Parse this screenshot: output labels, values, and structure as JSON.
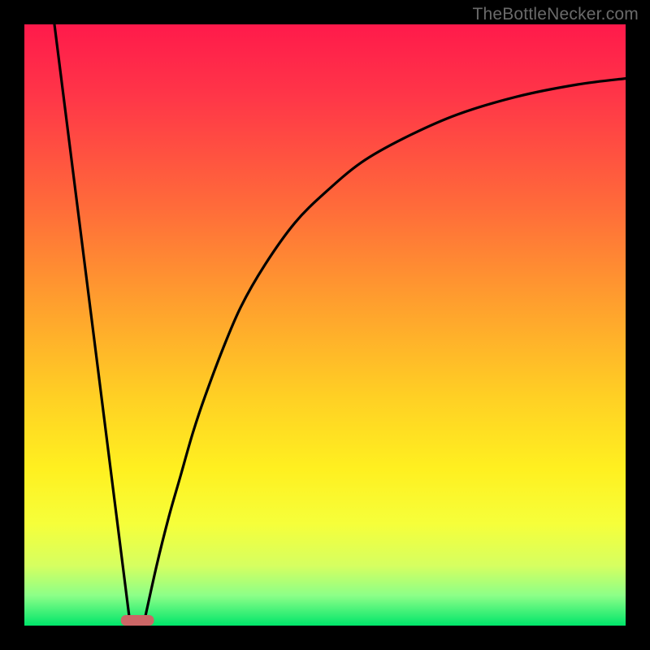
{
  "watermark": "TheBottleNecker.com",
  "chart_data": {
    "type": "line",
    "title": "",
    "xlabel": "",
    "ylabel": "",
    "xlim": [
      0,
      100
    ],
    "ylim": [
      0,
      100
    ],
    "gradient_stops": [
      {
        "offset": 0.0,
        "color": "#ff1a4b"
      },
      {
        "offset": 0.12,
        "color": "#ff3648"
      },
      {
        "offset": 0.3,
        "color": "#ff6a3a"
      },
      {
        "offset": 0.46,
        "color": "#ff9e2e"
      },
      {
        "offset": 0.62,
        "color": "#ffd024"
      },
      {
        "offset": 0.74,
        "color": "#fff020"
      },
      {
        "offset": 0.83,
        "color": "#f6ff3a"
      },
      {
        "offset": 0.9,
        "color": "#d6ff60"
      },
      {
        "offset": 0.95,
        "color": "#8cff88"
      },
      {
        "offset": 1.0,
        "color": "#00e56a"
      }
    ],
    "series": [
      {
        "name": "left-line",
        "x": [
          5,
          17.5
        ],
        "y": [
          100,
          1
        ]
      },
      {
        "name": "right-curve",
        "x": [
          20,
          22,
          24,
          26,
          28,
          30,
          33,
          36,
          40,
          45,
          50,
          56,
          63,
          72,
          82,
          92,
          100
        ],
        "y": [
          1,
          10,
          18,
          25,
          32,
          38,
          46,
          53,
          60,
          67,
          72,
          77,
          81,
          85,
          88,
          90,
          91
        ]
      }
    ],
    "marker": {
      "name": "bottom-marker",
      "x_center": 18.8,
      "width": 5.5,
      "color": "#cc6666"
    }
  }
}
